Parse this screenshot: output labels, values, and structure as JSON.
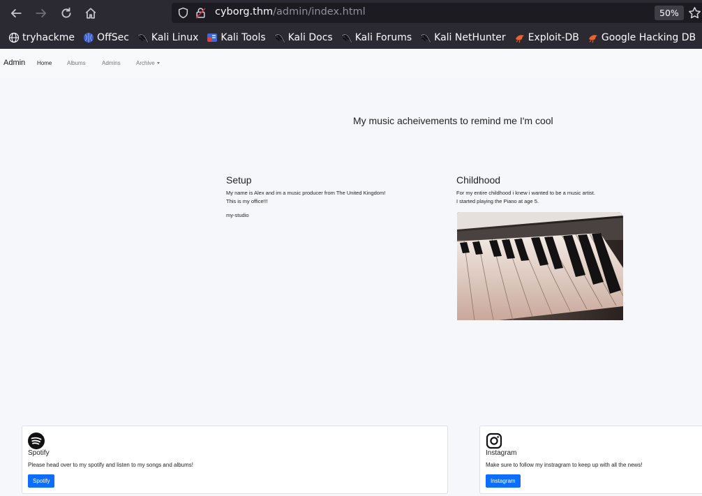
{
  "browser": {
    "url_host": "cyborg.thm",
    "url_path": "/admin/index.html",
    "zoom": "50%",
    "bookmarks": [
      {
        "label": "tryhackme",
        "icon": "globe-icon"
      },
      {
        "label": "OffSec",
        "icon": "offsec-icon"
      },
      {
        "label": "Kali Linux",
        "icon": "kali-dragon-icon"
      },
      {
        "label": "Kali Tools",
        "icon": "kali-tools-icon"
      },
      {
        "label": "Kali Docs",
        "icon": "kali-dragon-icon"
      },
      {
        "label": "Kali Forums",
        "icon": "kali-dragon-icon"
      },
      {
        "label": "Kali NetHunter",
        "icon": "kali-dragon-icon"
      },
      {
        "label": "Exploit-DB",
        "icon": "exploit-db-icon"
      },
      {
        "label": "Google Hacking DB",
        "icon": "exploit-db-icon"
      }
    ]
  },
  "nav": {
    "brand": "Admin",
    "items": [
      "Home",
      "Albums",
      "Admins",
      "Archive"
    ]
  },
  "hero": "My music acheivements to remind me I'm cool",
  "setup": {
    "title": "Setup",
    "line1": "My name is Alex and im a music producer from The United Kingdom!",
    "line2": "This is my office!!!",
    "image_alt": "my-studio"
  },
  "childhood": {
    "title": "Childhood",
    "line1": "For my entire childhood i knew i wanted to be a music artist.",
    "line2": "I started playing the Piano at age 5."
  },
  "spotify": {
    "title": "Spotify",
    "desc": "Please head over to my spotify and listen to my songs and albums!",
    "button": "Spotify"
  },
  "instagram": {
    "title": "Instagram",
    "desc": "Make sure to follow my instragram to keep up with all the news!",
    "button": "Instagram"
  },
  "colors": {
    "accent": "#0d6efd",
    "chrome_bg": "#2b2a33"
  }
}
